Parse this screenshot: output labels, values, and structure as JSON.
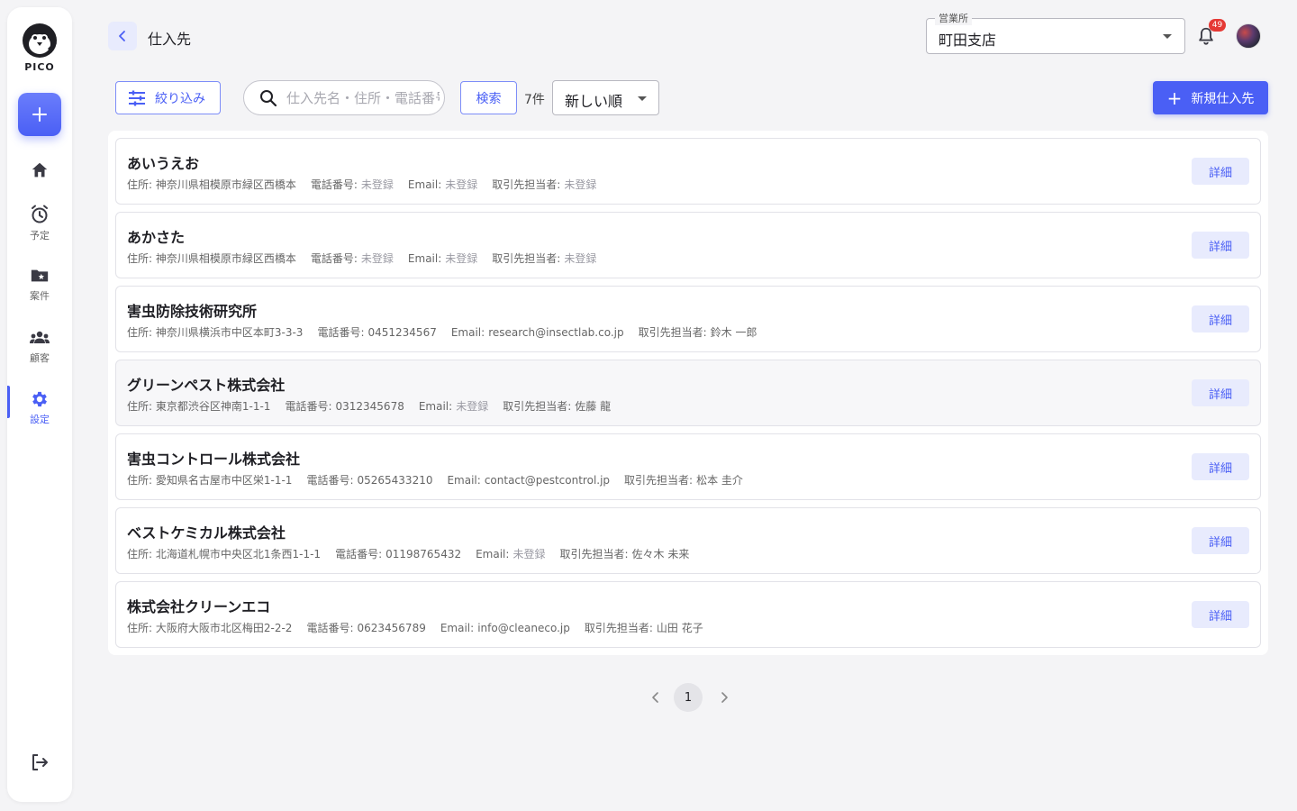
{
  "app": {
    "logo_text": "PICO"
  },
  "sidebar": {
    "items": [
      {
        "key": "home",
        "label": ""
      },
      {
        "key": "schedule",
        "label": "予定"
      },
      {
        "key": "cases",
        "label": "案件"
      },
      {
        "key": "customers",
        "label": "顧客"
      },
      {
        "key": "settings",
        "label": "設定"
      }
    ]
  },
  "header": {
    "title": "仕入先",
    "office_label": "営業所",
    "office_value": "町田支店",
    "notification_count": "49"
  },
  "toolbar": {
    "filter_label": "絞り込み",
    "search_placeholder": "仕入先名・住所・電話番号",
    "search_button": "検索",
    "count": "7件",
    "sort_value": "新しい順",
    "new_button": "新規仕入先"
  },
  "suppliers": [
    {
      "name": "あいうえお",
      "address": "住所: 神奈川県相模原市緑区西橋本",
      "phone_label": "電話番号:",
      "phone": "未登録",
      "email_label": "Email:",
      "email": "未登録",
      "contact_label": "取引先担当者:",
      "contact": "未登録",
      "detail": "詳細"
    },
    {
      "name": "あかさた",
      "address": "住所: 神奈川県相模原市緑区西橋本",
      "phone_label": "電話番号:",
      "phone": "未登録",
      "email_label": "Email:",
      "email": "未登録",
      "contact_label": "取引先担当者:",
      "contact": "未登録",
      "detail": "詳細"
    },
    {
      "name": "害虫防除技術研究所",
      "address": "住所: 神奈川県横浜市中区本町3-3-3",
      "phone_label": "電話番号:",
      "phone": "0451234567",
      "email_label": "Email:",
      "email": "research@insectlab.co.jp",
      "contact_label": "取引先担当者:",
      "contact": "鈴木 一郎",
      "detail": "詳細"
    },
    {
      "name": "グリーンペスト株式会社",
      "address": "住所: 東京都渋谷区神南1-1-1",
      "phone_label": "電話番号:",
      "phone": "0312345678",
      "email_label": "Email:",
      "email": "未登録",
      "contact_label": "取引先担当者:",
      "contact": "佐藤 龍",
      "detail": "詳細"
    },
    {
      "name": "害虫コントロール株式会社",
      "address": "住所: 愛知県名古屋市中区栄1-1-1",
      "phone_label": "電話番号:",
      "phone": "05265433210",
      "email_label": "Email:",
      "email": "contact@pestcontrol.jp",
      "contact_label": "取引先担当者:",
      "contact": "松本 圭介",
      "detail": "詳細"
    },
    {
      "name": "ベストケミカル株式会社",
      "address": "住所: 北海道札幌市中央区北1条西1-1-1",
      "phone_label": "電話番号:",
      "phone": "01198765432",
      "email_label": "Email:",
      "email": "未登録",
      "contact_label": "取引先担当者:",
      "contact": "佐々木 未来",
      "detail": "詳細"
    },
    {
      "name": "株式会社クリーンエコ",
      "address": "住所: 大阪府大阪市北区梅田2-2-2",
      "phone_label": "電話番号:",
      "phone": "0623456789",
      "email_label": "Email:",
      "email": "info@cleaneco.jp",
      "contact_label": "取引先担当者:",
      "contact": "山田 花子",
      "detail": "詳細"
    }
  ],
  "pagination": {
    "current": "1"
  },
  "colors": {
    "accent": "#4a5ff5",
    "accent_light": "#e8ebfd",
    "badge": "#e53935"
  }
}
